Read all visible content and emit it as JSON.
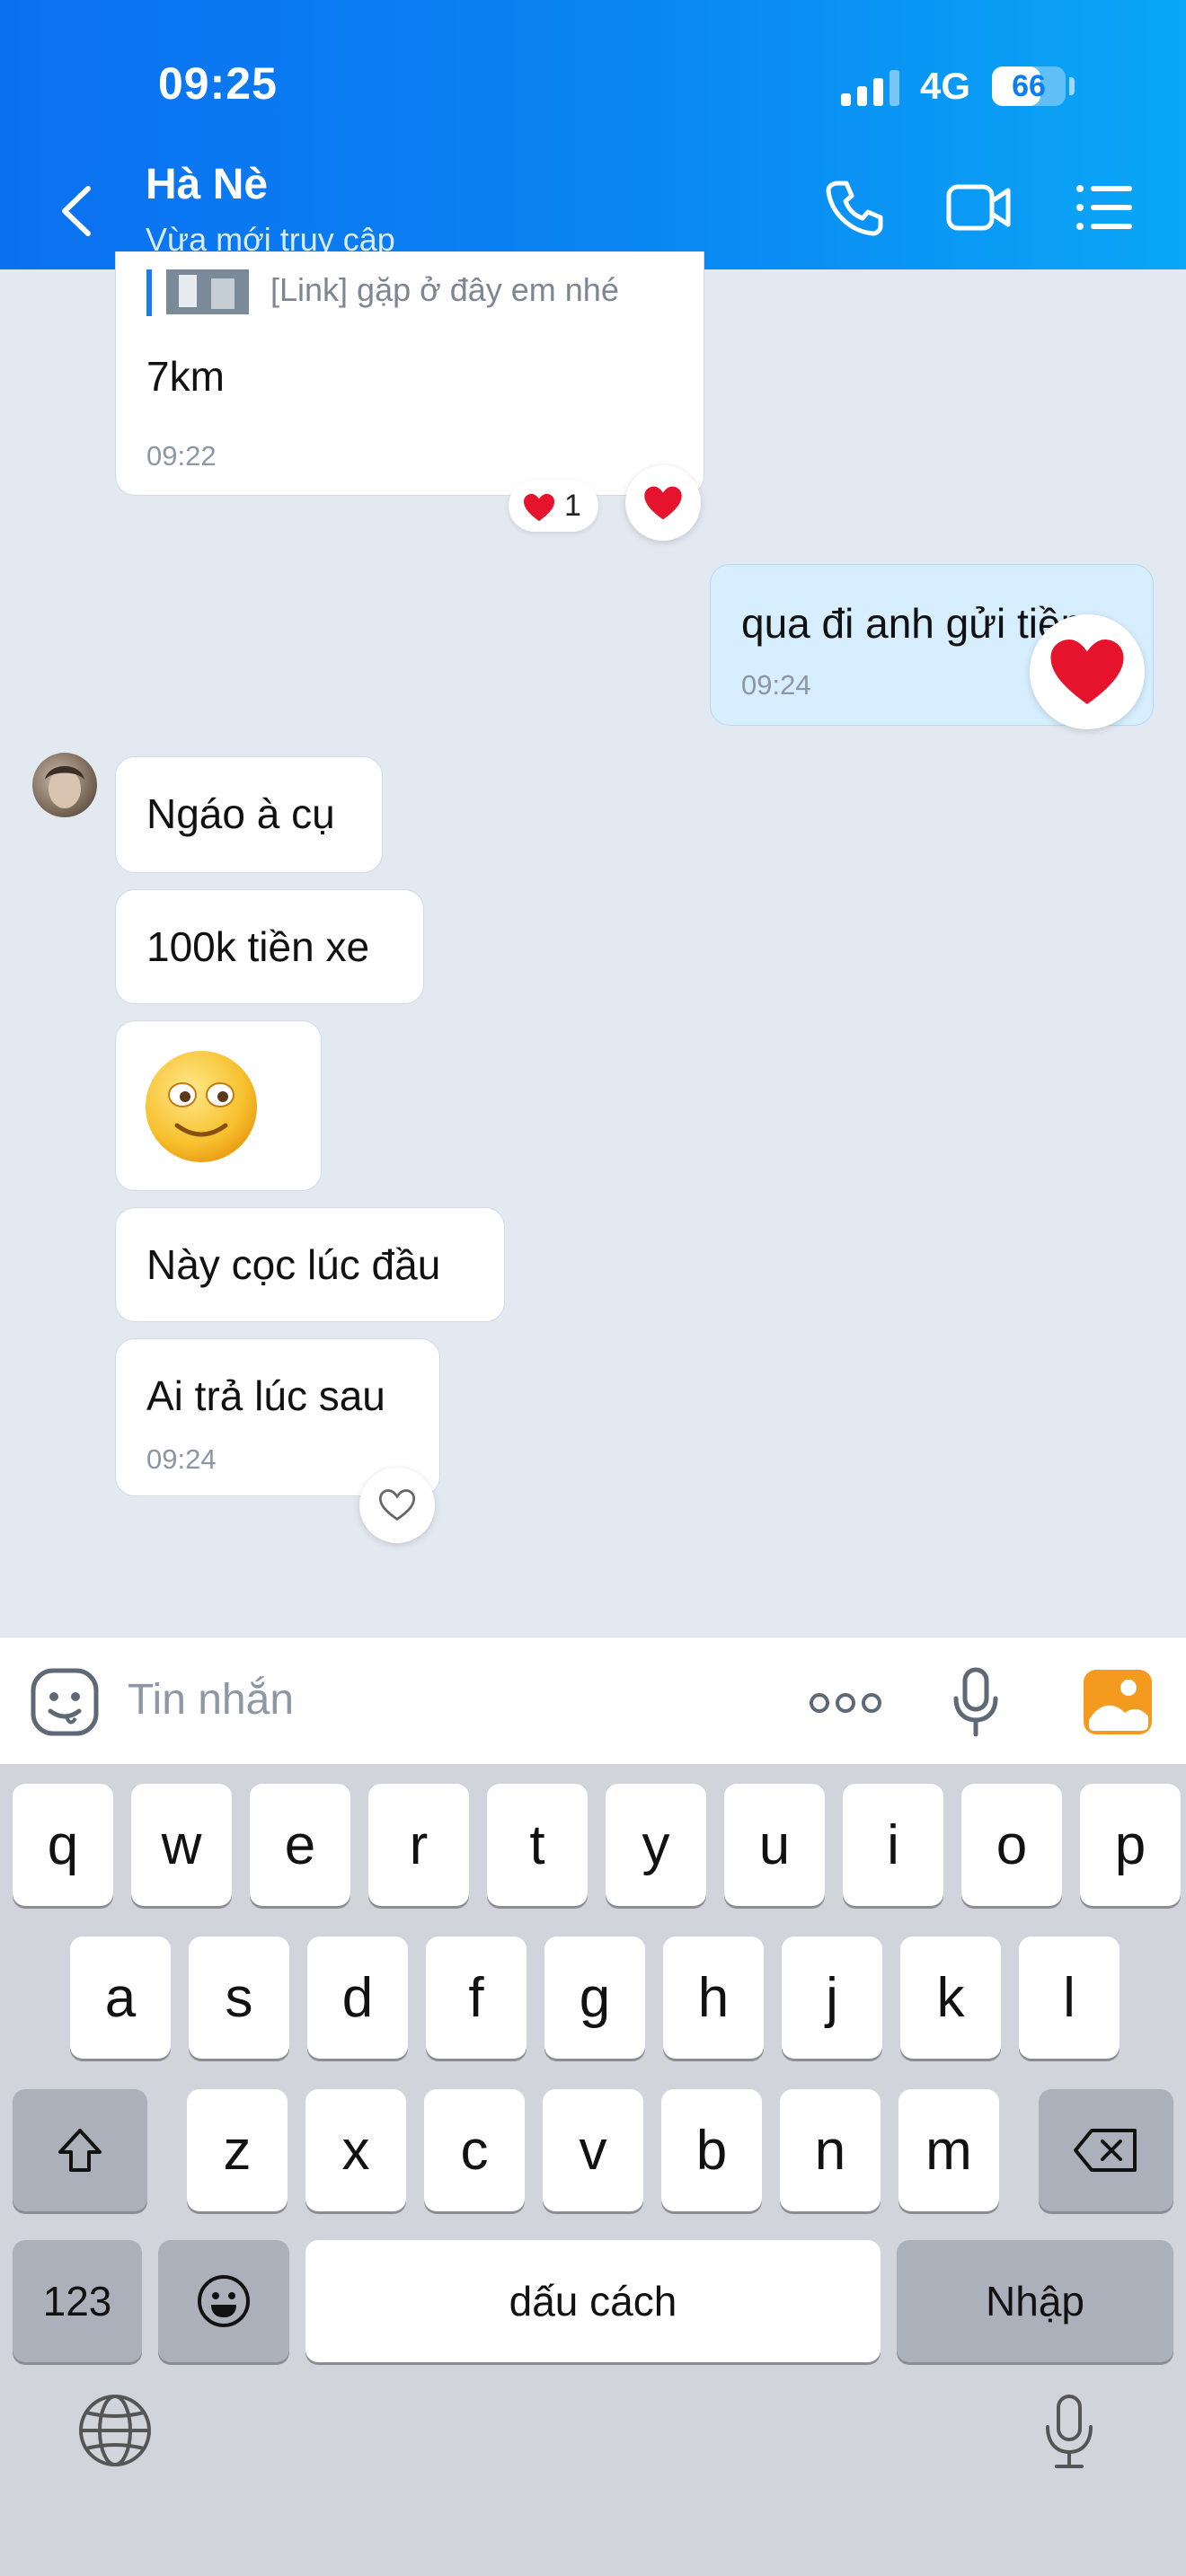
{
  "status_bar": {
    "time": "09:25",
    "network": "4G",
    "battery": "66",
    "battery_level": 0.66
  },
  "header": {
    "name": "Hà Nè",
    "status": "Vừa mới truy cập"
  },
  "messages": {
    "m1": {
      "link_text": "[Link] gặp ở đây em nhé",
      "text": "7km",
      "time": "09:22",
      "reaction_count": "1"
    },
    "m2": {
      "text": "qua đi anh gửi tiền",
      "time": "09:24"
    },
    "m3": {
      "text": "Ngáo à cụ"
    },
    "m4": {
      "text": "100k tiền xe"
    },
    "m5": {
      "sticker": "smiling-face-sticker"
    },
    "m6": {
      "text": "Này cọc lúc đầu"
    },
    "m7": {
      "text": "Ai trả lúc sau",
      "time": "09:24"
    }
  },
  "input": {
    "placeholder": "Tin nhắn"
  },
  "keyboard": {
    "row1": [
      "q",
      "w",
      "e",
      "r",
      "t",
      "y",
      "u",
      "i",
      "o",
      "p"
    ],
    "row2": [
      "a",
      "s",
      "d",
      "f",
      "g",
      "h",
      "j",
      "k",
      "l"
    ],
    "row3": [
      "z",
      "x",
      "c",
      "v",
      "b",
      "n",
      "m"
    ],
    "numbers_label": "123",
    "space_label": "dấu cách",
    "return_label": "Nhập"
  },
  "colors": {
    "header_start": "#0b70f0",
    "header_end": "#0aa7f6",
    "my_bubble": "#d6eefe",
    "chat_bg": "#e3e9f1",
    "heart": "#e5132b"
  }
}
